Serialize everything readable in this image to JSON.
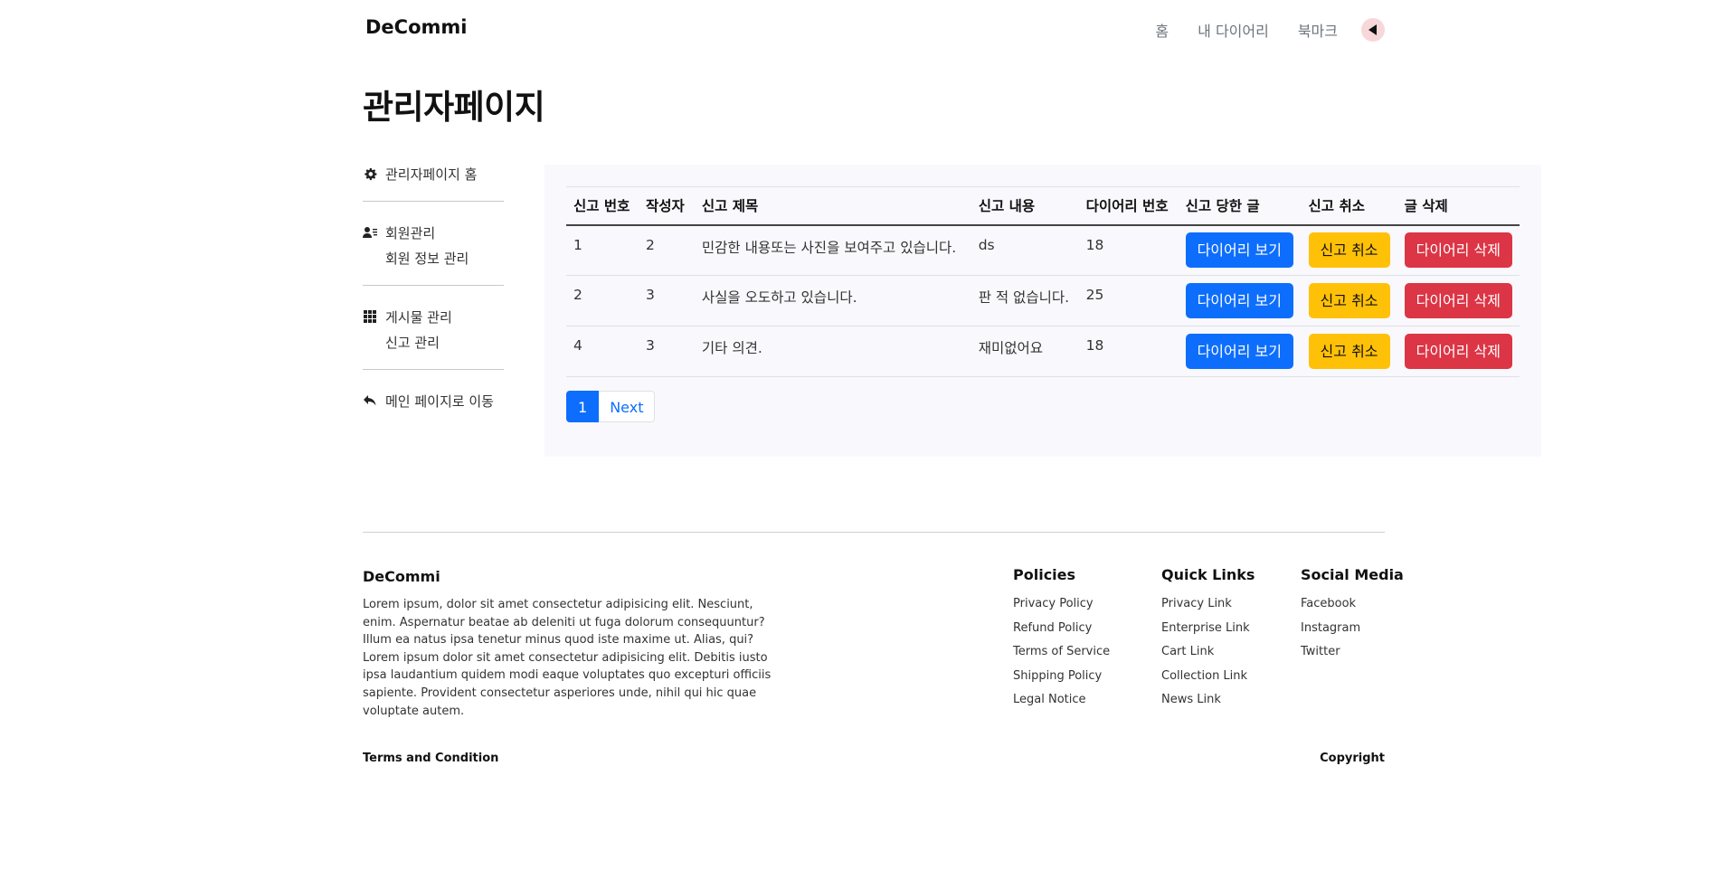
{
  "navbar": {
    "brand": "DeCommi",
    "links": [
      "홈",
      "내 다이어리",
      "북마크"
    ]
  },
  "page_title": "관리자페이지",
  "sidebar": {
    "home": "관리자페이지 홈",
    "member_group": "회원관리",
    "member_sub": "회원 정보 관리",
    "post_group": "게시물 관리",
    "post_sub": "신고 관리",
    "back": "메인 페이지로 이동"
  },
  "table": {
    "headers": [
      "신고 번호",
      "작성자",
      "신고 제목",
      "신고 내용",
      "다이어리 번호",
      "신고 당한 글",
      "신고 취소",
      "글 삭제"
    ],
    "rows": [
      {
        "id": "1",
        "author": "2",
        "title": "민감한 내용또는 사진을 보여주고 있습니다.",
        "content": "ds",
        "diary": "18"
      },
      {
        "id": "2",
        "author": "3",
        "title": "사실을 오도하고 있습니다.",
        "content": "판 적 없습니다.",
        "diary": "25"
      },
      {
        "id": "4",
        "author": "3",
        "title": "기타 의견.",
        "content": "재미없어요",
        "diary": "18"
      }
    ],
    "view_btn": "다이어리 보기",
    "cancel_btn": "신고 취소",
    "delete_btn": "다이어리 삭제"
  },
  "pagination": {
    "current": "1",
    "next": "Next"
  },
  "colors": {
    "primary": "#0d6efd",
    "warning": "#ffc107",
    "danger": "#dc3545",
    "panel_bg": "#f9f8fd"
  },
  "footer": {
    "brand": "DeCommi",
    "text": "Lorem ipsum, dolor sit amet consectetur adipisicing elit. Nesciunt, enim. Aspernatur beatae ab deleniti ut fuga dolorum consequuntur? Illum ea natus ipsa tenetur minus quod iste maxime ut. Alias, qui? Lorem ipsum dolor sit amet consectetur adipisicing elit. Debitis iusto ipsa laudantium quidem modi eaque voluptates quo excepturi officiis sapiente. Provident consectetur asperiores unde, nihil qui hic quae voluptate autem.",
    "policies": {
      "title": "Policies",
      "links": [
        "Privacy Policy",
        "Refund Policy",
        "Terms of Service",
        "Shipping Policy",
        "Legal Notice"
      ]
    },
    "quick": {
      "title": "Quick Links",
      "links": [
        "Privacy Link",
        "Enterprise Link",
        "Cart Link",
        "Collection Link",
        "News Link"
      ]
    },
    "social": {
      "title": "Social Media",
      "links": [
        "Facebook",
        "Instagram",
        "Twitter"
      ]
    },
    "terms": "Terms and Condition",
    "copyright": "Copyright"
  }
}
